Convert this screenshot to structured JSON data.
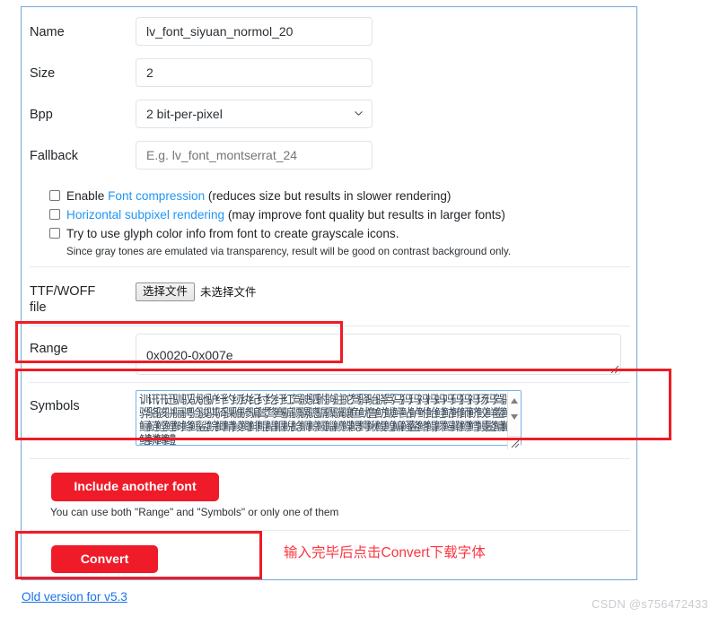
{
  "form": {
    "rows": [
      {
        "label": "Name",
        "value": "lv_font_siyuan_normol_20",
        "placeholder": ""
      },
      {
        "label": "Size",
        "value": "2",
        "placeholder": ""
      },
      {
        "label": "Bpp",
        "value": "2 bit-per-pixel",
        "placeholder": ""
      },
      {
        "label": "Fallback",
        "value": "",
        "placeholder": "E.g. lv_font_montserrat_24"
      }
    ],
    "bpp_selected": "2 bit-per-pixel",
    "file_row": {
      "label_line1": "TTF/WOFF",
      "label_line2": "file",
      "button_label": "选择文件",
      "status": "未选择文件"
    },
    "range_row": {
      "label": "Range",
      "value": "0x0020-0x007e"
    },
    "symbols_row": {
      "label": "Symbols",
      "value": "训讯汛迅驯驭驮驰驴纤约纫纨纪纣纥纡红驾驶驷驸驹驻驼驽驿骀骁骂马犸玛祃杩蚂吗码犸祃玚玛驾骄骅骆骇骈骊骋验骏骐骑骒骓骖骗骘骛骞骟骠骡骢骣骤骥骧鱼鱿鲁鲂鲅鲆鲇鲈鲋鲐鲑鲒鲔鲕鲚鲛鲜鲞鲠鲡鲢鲣鲤鲥鲦鲧鲨鲩鲫鲭鲮鲰鲱鲲鲳鲴鲵鲶鲷鲸鲺鲻鲼鲽鳃鳄鳅鳆鳇鳊鳋鳌鳍鳎鳏鳐鳓鳔鳕鳗鳘鳙鳜鳝鳞鳟鳢\n鳍鳌鳞鸟鸠鸡鸣鸥鸦鸭鸯鸳驼鸽鸿鹃鹅鹄鹊鹏鹤鹦鹰鹿麦麸麻黄黍黎黑黔默鼎鼓鼠鼻齐\n齿龄龙龟"
    },
    "include_button_label": "Include another font",
    "include_helper": "You can use both \"Range\" and \"Symbols\" or only one of them",
    "convert_button_label": "Convert"
  },
  "checkboxes": [
    {
      "pre": "Enable ",
      "link": "Font compression",
      "post": " (reduces size but results in slower rendering)",
      "checked": false
    },
    {
      "pre": "",
      "link": "Horizontal subpixel rendering",
      "post": " (may improve font quality but results in larger fonts)",
      "checked": false
    },
    {
      "pre": "Try to use glyph color info from font to create grayscale icons.",
      "link": "",
      "post": "",
      "checked": false
    }
  ],
  "grayscale_note": "Since gray tones are emulated via transparency, result will be good on contrast background only.",
  "old_version_link": "Old version for v5.3",
  "annotation": {
    "text": "输入完毕后点击Convert下载字体",
    "color": "#fb3640"
  },
  "watermark": "CSDN @s756472433",
  "colors": {
    "accent_red": "#f01b28",
    "annotation_red": "#ee1c25",
    "link_blue": "#2196f3",
    "card_border": "#73a6d8"
  }
}
